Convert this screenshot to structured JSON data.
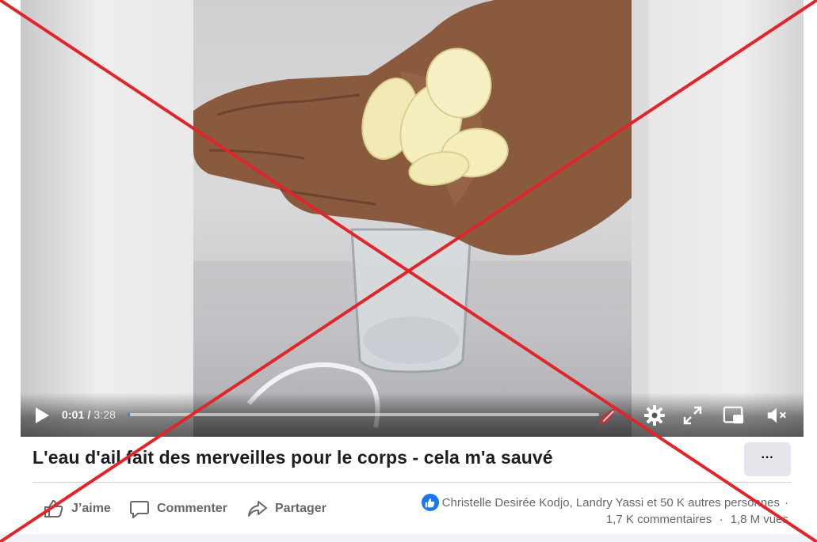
{
  "video": {
    "current_time": "0:01",
    "duration": "3:28",
    "progress_fraction": 0.003
  },
  "post": {
    "title": "L'eau d'ail fait des merveilles pour le corps - cela m'a sauvé",
    "more_label": "···"
  },
  "actions": {
    "like": "J’aime",
    "comment": "Commenter",
    "share": "Partager"
  },
  "reactions": {
    "text": "Christelle Desirée Kodjo, Landry Yassi et 50 K autres personnes",
    "separator": "·"
  },
  "stats": {
    "comments": "1,7 K commentaires",
    "separator": "·",
    "views": "1,8 M vues"
  },
  "icons": {
    "play": "play-icon",
    "settings": "gear-icon",
    "fullscreen": "fullscreen-icon",
    "pip": "picture-in-picture-icon",
    "mute": "muted-speaker-icon",
    "like": "thumbs-up-icon",
    "comment": "speech-bubble-icon",
    "share": "share-arrow-icon"
  },
  "colors": {
    "accent": "#1877f2",
    "cross": "#e0252b",
    "title": "#1c1e21",
    "secondary_text": "#65676b"
  }
}
